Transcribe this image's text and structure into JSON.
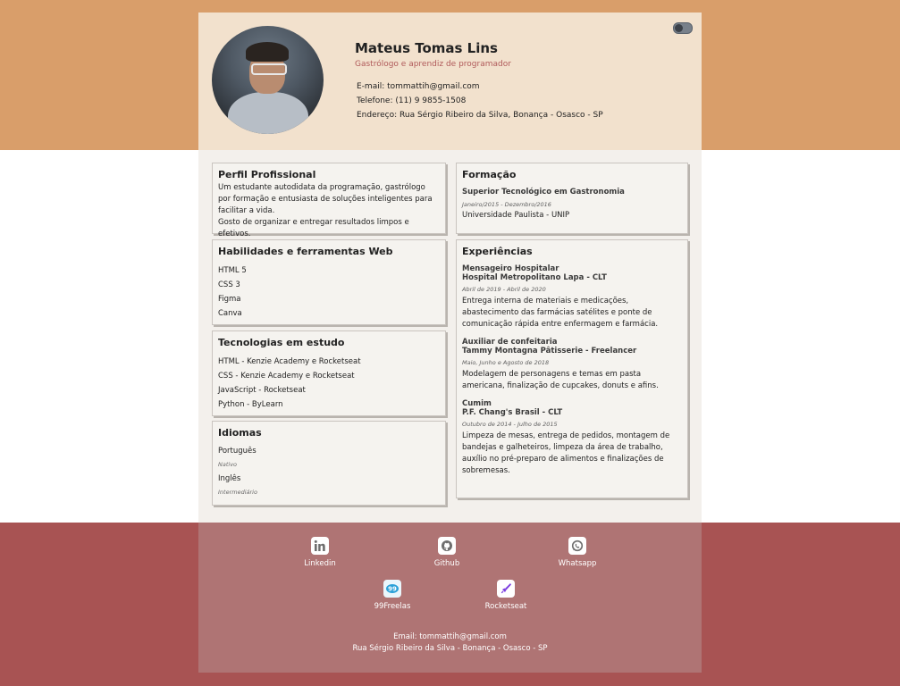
{
  "header": {
    "name": "Mateus Tomas Lins",
    "role": "Gastrólogo e aprendiz de programador",
    "email": "E-mail: tommattih@gmail.com",
    "phone": "Telefone: (11) 9 9855-1508",
    "address": "Endereço: Rua Sérgio Ribeiro da Silva, Bonança - Osasco - SP"
  },
  "profile": {
    "title": "Perfil Profissional",
    "text1": "Um estudante autodidata da programação, gastrólogo por formação e entusiasta de soluções inteligentes para facilitar a vida.",
    "text2": "Gosto de organizar e entregar resultados limpos e efetivos."
  },
  "skills": {
    "title": "Habilidades e ferramentas Web",
    "items": [
      "HTML 5",
      "CSS 3",
      "Figma",
      "Canva"
    ]
  },
  "studying": {
    "title": "Tecnologias em estudo",
    "items": [
      "HTML - Kenzie Academy e Rocketseat",
      "CSS - Kenzie Academy e Rocketseat",
      "JavaScript - Rocketseat",
      "Python - ByLearn"
    ]
  },
  "languages": {
    "title": "Idiomas",
    "items": [
      {
        "name": "Português",
        "level": "Nativo"
      },
      {
        "name": "Inglês",
        "level": "Intermediário"
      }
    ]
  },
  "education": {
    "title": "Formação",
    "course": "Superior Tecnológico em Gastronomia",
    "period": "Janeiro/2015 - Dezembro/2016",
    "school": "Universidade Paulista - UNIP"
  },
  "experience": {
    "title": "Experiências",
    "items": [
      {
        "role": "Mensageiro Hospitalar",
        "company": "Hospital Metropolitano Lapa - CLT",
        "period": "Abril de 2019 - Abril de 2020",
        "desc": "Entrega interna de materiais e medicações, abastecimento das farmácias satélites e ponte de comunicação rápida entre enfermagem e farmácia."
      },
      {
        "role": "Auxiliar de confeitaria",
        "company": "Tammy Montagna Pâtisserie - Freelancer",
        "period": "Maio, Junho e Agosto de 2018",
        "desc": "Modelagem de personagens e temas em pasta americana, finalização de cupcakes, donuts e afins."
      },
      {
        "role": "Cumim",
        "company": "P.F. Chang's Brasil - CLT",
        "period": "Outubro de 2014 - Julho de 2015",
        "desc": "Limpeza de mesas, entrega de pedidos, montagem de bandejas e galheteiros, limpeza da área de trabalho, auxílio no pré-preparo de alimentos e finalizações de sobremesas."
      }
    ]
  },
  "footer": {
    "links": [
      {
        "label": "Linkedin",
        "icon": "linkedin-icon",
        "color": "#6e6e6e"
      },
      {
        "label": "Github",
        "icon": "github-icon",
        "color": "#6e6e6e"
      },
      {
        "label": "Whatsapp",
        "icon": "whatsapp-icon",
        "color": "#6e6e6e"
      },
      {
        "label": "99Freelas",
        "icon": "99freelas-icon",
        "color": "#2ba1d9"
      },
      {
        "label": "Rocketseat",
        "icon": "rocketseat-icon",
        "color": "#7c3fe0"
      }
    ],
    "email": "Email: tommattih@gmail.com",
    "address": "Rua Sérgio Ribeiro da Silva - Bonança - Osasco - SP"
  },
  "colors": {
    "top_band": "#d99e6a",
    "bottom_band": "#a85353",
    "header_bg": "#f2e1cd",
    "footer_bg": "#af7474",
    "role_text": "#b05a5a"
  }
}
